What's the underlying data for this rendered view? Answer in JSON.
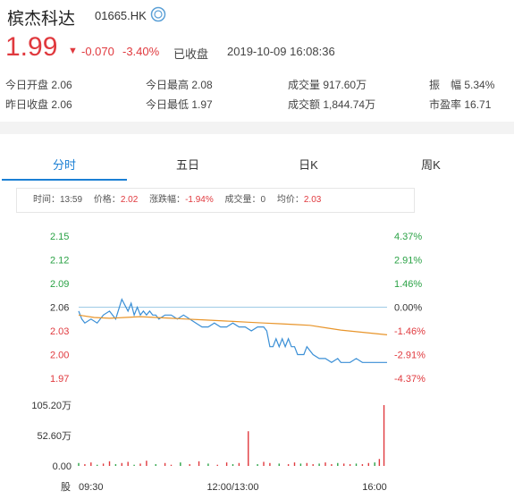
{
  "header": {
    "name": "槟杰科达",
    "code": "01665.HK",
    "price": "1.99",
    "change": "-0.070",
    "change_pct": "-3.40%",
    "status": "已收盘",
    "timestamp": "2019-10-09 16:08:36",
    "down_color": "#e0393e",
    "up_color": "#2aa245",
    "accent": "#1a7fd4"
  },
  "stats": {
    "open_label": "今日开盘",
    "open": "2.06",
    "high_label": "今日最高",
    "high": "2.08",
    "volume_label": "成交量",
    "volume": "917.60万",
    "amp_label": "振　幅",
    "amp": "5.34%",
    "prev_label": "昨日收盘",
    "prev": "2.06",
    "low_label": "今日最低",
    "low": "1.97",
    "turnover_label": "成交额",
    "turnover": "1,844.74万",
    "pe_label": "市盈率",
    "pe": "16.71"
  },
  "tabs": [
    "分时",
    "五日",
    "日K",
    "周K"
  ],
  "info": {
    "time_label": "时间：",
    "time": "13:59",
    "price_label": "价格：",
    "price": "2.02",
    "chg_label": "涨跌幅：",
    "chg": "-1.94%",
    "vol_label": "成交量：",
    "vol": "0",
    "avg_label": "均价：",
    "avg": "2.03"
  },
  "chart_data": {
    "type": "line",
    "y_ticks": [
      "2.15",
      "2.12",
      "2.09",
      "2.06",
      "2.03",
      "2.00",
      "1.97"
    ],
    "pct_ticks": [
      "4.37%",
      "2.91%",
      "1.46%",
      "0.00%",
      "-1.46%",
      "-2.91%",
      "-4.37%"
    ],
    "x_ticks": [
      "09:30",
      "12:00/13:00",
      "16:00"
    ],
    "ylim": [
      1.97,
      2.15
    ],
    "prev_close": 2.06,
    "volume_ticks": [
      "105.20万",
      "52.60万",
      "0.00"
    ],
    "volume_axis_label": "股",
    "series": [
      {
        "name": "price",
        "color": "#3a8fd6",
        "x": [
          0,
          0.01,
          0.02,
          0.04,
          0.06,
          0.08,
          0.1,
          0.12,
          0.14,
          0.16,
          0.17,
          0.18,
          0.19,
          0.2,
          0.21,
          0.22,
          0.23,
          0.24,
          0.25,
          0.26,
          0.28,
          0.3,
          0.32,
          0.34,
          0.36,
          0.38,
          0.4,
          0.42,
          0.44,
          0.46,
          0.48,
          0.5,
          0.52,
          0.54,
          0.56,
          0.58,
          0.6,
          0.61,
          0.62,
          0.63,
          0.64,
          0.65,
          0.66,
          0.67,
          0.68,
          0.69,
          0.7,
          0.71,
          0.72,
          0.73,
          0.74,
          0.76,
          0.78,
          0.8,
          0.82,
          0.84,
          0.85,
          0.86,
          0.88,
          0.9,
          0.92,
          0.94,
          0.96,
          0.98,
          1.0
        ],
        "values": [
          2.055,
          2.045,
          2.04,
          2.045,
          2.04,
          2.05,
          2.055,
          2.045,
          2.07,
          2.055,
          2.065,
          2.05,
          2.06,
          2.05,
          2.055,
          2.05,
          2.055,
          2.05,
          2.05,
          2.045,
          2.05,
          2.05,
          2.045,
          2.05,
          2.045,
          2.04,
          2.035,
          2.035,
          2.04,
          2.035,
          2.035,
          2.04,
          2.035,
          2.035,
          2.03,
          2.035,
          2.035,
          2.03,
          2.01,
          2.01,
          2.02,
          2.01,
          2.02,
          2.01,
          2.02,
          2.01,
          2.01,
          2.0,
          2.0,
          2.0,
          2.01,
          2.0,
          1.995,
          1.995,
          1.99,
          1.995,
          1.99,
          1.99,
          1.99,
          1.995,
          1.99,
          1.99,
          1.99,
          1.99,
          1.99
        ]
      },
      {
        "name": "average",
        "color": "#e8952b",
        "x": [
          0,
          0.05,
          0.1,
          0.15,
          0.2,
          0.25,
          0.3,
          0.35,
          0.4,
          0.45,
          0.5,
          0.55,
          0.6,
          0.65,
          0.7,
          0.75,
          0.8,
          0.85,
          0.9,
          0.95,
          1.0
        ],
        "values": [
          2.05,
          2.047,
          2.046,
          2.047,
          2.048,
          2.047,
          2.046,
          2.045,
          2.044,
          2.043,
          2.042,
          2.041,
          2.04,
          2.039,
          2.038,
          2.037,
          2.034,
          2.031,
          2.029,
          2.027,
          2.025
        ]
      }
    ],
    "volume_bars": [
      {
        "x": 0.0,
        "v": 5
      },
      {
        "x": 0.02,
        "v": 3
      },
      {
        "x": 0.04,
        "v": 6
      },
      {
        "x": 0.06,
        "v": 2
      },
      {
        "x": 0.08,
        "v": 4
      },
      {
        "x": 0.1,
        "v": 8
      },
      {
        "x": 0.12,
        "v": 3
      },
      {
        "x": 0.14,
        "v": 5
      },
      {
        "x": 0.16,
        "v": 7
      },
      {
        "x": 0.18,
        "v": 2
      },
      {
        "x": 0.2,
        "v": 4
      },
      {
        "x": 0.22,
        "v": 9
      },
      {
        "x": 0.25,
        "v": 3
      },
      {
        "x": 0.28,
        "v": 5
      },
      {
        "x": 0.3,
        "v": 2
      },
      {
        "x": 0.33,
        "v": 6
      },
      {
        "x": 0.36,
        "v": 3
      },
      {
        "x": 0.39,
        "v": 8
      },
      {
        "x": 0.42,
        "v": 4
      },
      {
        "x": 0.45,
        "v": 2
      },
      {
        "x": 0.48,
        "v": 6
      },
      {
        "x": 0.5,
        "v": 3
      },
      {
        "x": 0.52,
        "v": 5
      },
      {
        "x": 0.55,
        "v": 4
      },
      {
        "x": 0.58,
        "v": 3
      },
      {
        "x": 0.6,
        "v": 7
      },
      {
        "x": 0.62,
        "v": 5
      },
      {
        "x": 0.65,
        "v": 4
      },
      {
        "x": 0.68,
        "v": 3
      },
      {
        "x": 0.7,
        "v": 6
      },
      {
        "x": 0.72,
        "v": 4
      },
      {
        "x": 0.74,
        "v": 5
      },
      {
        "x": 0.76,
        "v": 3
      },
      {
        "x": 0.78,
        "v": 4
      },
      {
        "x": 0.8,
        "v": 6
      },
      {
        "x": 0.82,
        "v": 3
      },
      {
        "x": 0.84,
        "v": 5
      },
      {
        "x": 0.86,
        "v": 4
      },
      {
        "x": 0.88,
        "v": 3
      },
      {
        "x": 0.9,
        "v": 4
      },
      {
        "x": 0.92,
        "v": 3
      },
      {
        "x": 0.94,
        "v": 5
      },
      {
        "x": 0.96,
        "v": 6
      },
      {
        "x": 0.975,
        "v": 12
      },
      {
        "x": 0.99,
        "v": 105.2
      }
    ],
    "volume_spike_mid": {
      "x": 0.55,
      "v": 60
    }
  }
}
